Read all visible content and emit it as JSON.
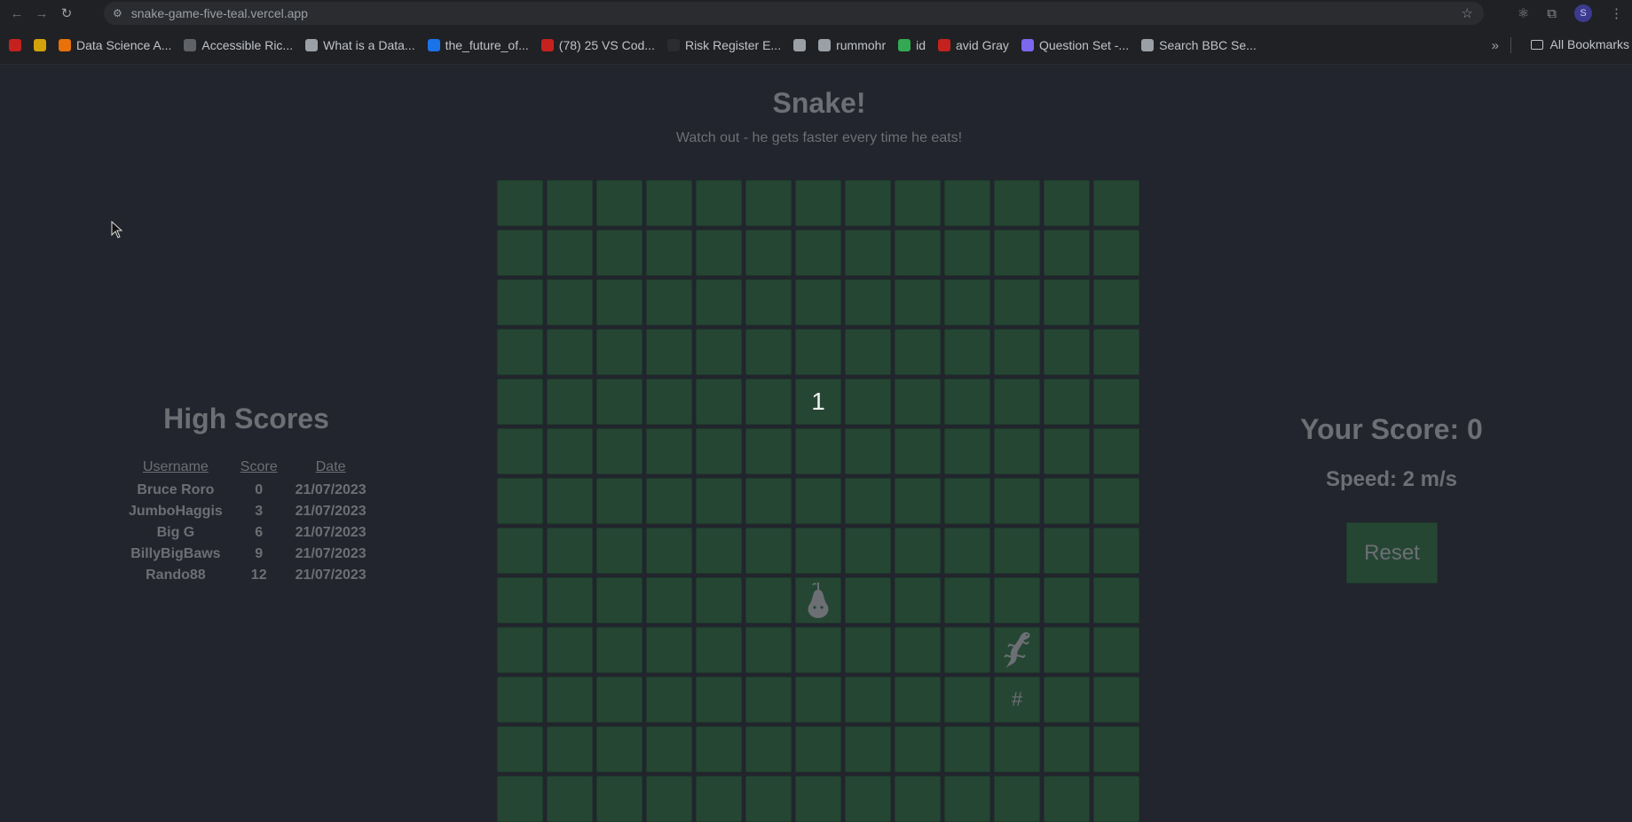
{
  "browser": {
    "url": "snake-game-five-teal.vercel.app",
    "avatar_letter": "S",
    "bookmarks": [
      {
        "label": "",
        "icon": "gmail-icon",
        "color": "#c5221f"
      },
      {
        "label": "",
        "icon": "globe-icon",
        "color": "#d4a20a"
      },
      {
        "label": "Data Science A...",
        "icon": "flame-icon",
        "color": "#e8710a"
      },
      {
        "label": "Accessible Ric...",
        "icon": "w-icon",
        "color": "#5f6368"
      },
      {
        "label": "What is a Data...",
        "icon": "globe-icon",
        "color": "#9aa0a6"
      },
      {
        "label": "the_future_of...",
        "icon": "doc-icon",
        "color": "#1a73e8"
      },
      {
        "label": "(78) 25 VS Cod...",
        "icon": "youtube-icon",
        "color": "#c5221f"
      },
      {
        "label": "Risk Register E...",
        "icon": "doc-icon",
        "color": "#2a2c30"
      },
      {
        "label": "",
        "icon": "globe-icon",
        "color": "#9aa0a6"
      },
      {
        "label": "rummohr",
        "icon": "globe-icon",
        "color": "#9aa0a6"
      },
      {
        "label": "id",
        "icon": "google-icon",
        "color": "#34a853"
      },
      {
        "label": "avid Gray",
        "icon": "youtube-icon",
        "color": "#c5221f"
      },
      {
        "label": "Question Set -...",
        "icon": "m-icon",
        "color": "#7b68ee"
      },
      {
        "label": "Search BBC Se...",
        "icon": "globe-icon",
        "color": "#9aa0a6"
      }
    ],
    "all_bookmarks": "All Bookmarks"
  },
  "page": {
    "title": "Snake!",
    "subtitle": "Watch out - he gets faster every time he eats!"
  },
  "board": {
    "cols": 13,
    "rows": 13,
    "timer": {
      "row": 4,
      "col": 6,
      "text": "1"
    },
    "food": {
      "row": 8,
      "col": 6,
      "icon": "pear-icon"
    },
    "snake_head": {
      "row": 9,
      "col": 10,
      "icon": "lizard-icon"
    },
    "snake_body": [
      {
        "row": 10,
        "col": 10,
        "text": "#"
      }
    ]
  },
  "high_scores": {
    "title": "High Scores",
    "headers": [
      "Username",
      "Score",
      "Date"
    ],
    "rows": [
      [
        "Bruce Roro",
        "0",
        "21/07/2023"
      ],
      [
        "JumboHaggis",
        "3",
        "21/07/2023"
      ],
      [
        "Big G",
        "6",
        "21/07/2023"
      ],
      [
        "BillyBigBaws",
        "9",
        "21/07/2023"
      ],
      [
        "Rando88",
        "12",
        "21/07/2023"
      ]
    ]
  },
  "status": {
    "score_text": "Your Score: 0",
    "speed_text": "Speed: 2 m/s",
    "reset_label": "Reset"
  }
}
